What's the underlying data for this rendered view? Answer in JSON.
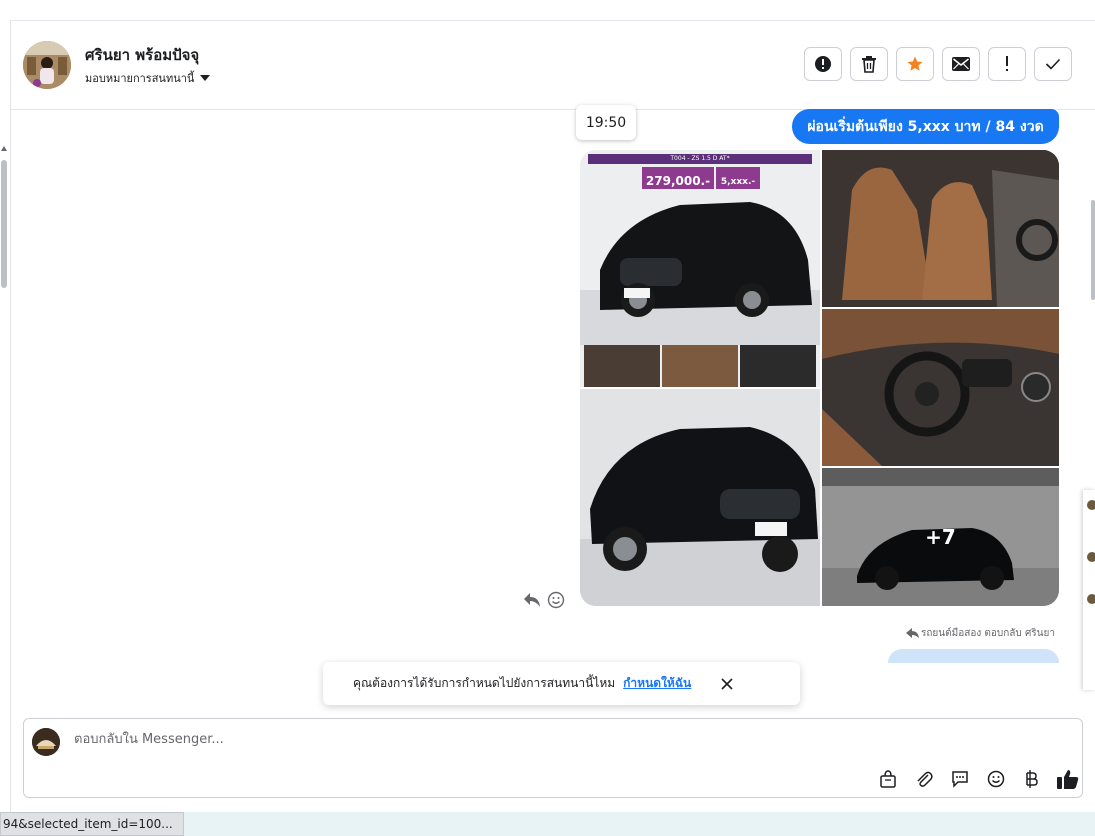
{
  "header": {
    "contact_name": "ศรินยา พร้อมปัจจุ",
    "assign_label": "มอบหมายการสนทนานี้",
    "actions": [
      "alert-circle-icon",
      "trash-icon",
      "star-icon",
      "mail-icon",
      "exclamation-icon",
      "check-icon"
    ]
  },
  "conversation": {
    "timestamp": "19:50",
    "message_text": "ผ่อนเริ่มต้นเพียง 5,xxx บาท / 84 งวด",
    "image_banner": "T004 - ZS 1.5 D AT*",
    "image_price": "279,000.-",
    "image_installment": "5,xxx.-",
    "more_count": "+7",
    "reply_meta": "รถยนต์มือสอง ตอบกลับ ศรินยา"
  },
  "toast": {
    "text": "คุณต้องการได้รับการกำหนดไปยังการสนทนานี้ไหม",
    "link": "กำหนดให้ฉัน"
  },
  "composer": {
    "placeholder": "ตอบกลับใน Messenger...",
    "tools": [
      "bag-icon",
      "paperclip-icon",
      "saved-reply-icon",
      "emoji-icon",
      "baht-icon",
      "thumbs-up-icon"
    ]
  },
  "statusbar": {
    "url_fragment": "94&selected_item_id=100..."
  },
  "colors": {
    "accent": "#1877f2",
    "star": "#f5821f",
    "bubble_text": "#ffffff"
  }
}
